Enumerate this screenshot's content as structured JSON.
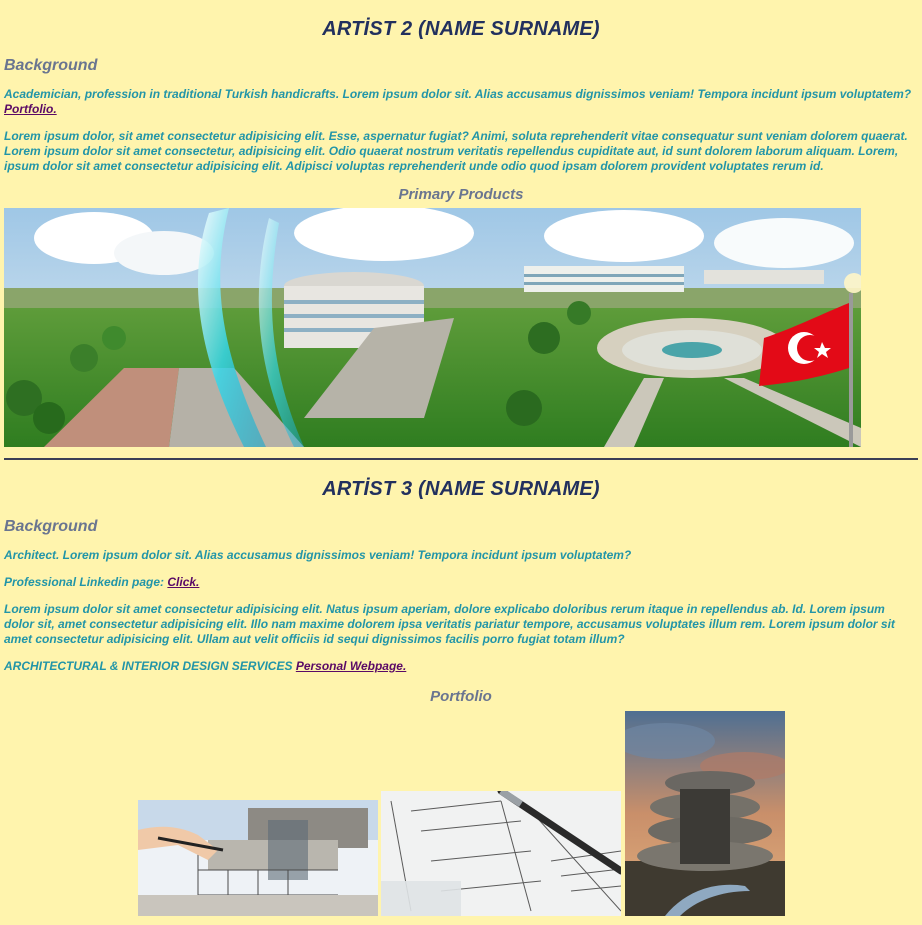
{
  "artist2": {
    "title": "ARTİST 2 (NAME SURNAME)",
    "background_heading": "Background",
    "intro_text": "Academician, profession in traditional Turkish handicrafts. Lorem ipsum dolor sit. Alias accusamus dignissimos veniam! Tempora incidunt ipsum voluptatem? ",
    "portfolio_link": "Portfolio.",
    "body_text": "Lorem ipsum dolor, sit amet consectetur adipisicing elit. Esse, aspernatur fugiat? Animi, soluta reprehenderit vitae consequatur sunt veniam dolorem quaerat. Lorem ipsum dolor sit amet consectetur, adipisicing elit. Odio quaerat nostrum veritatis repellendus cupiditate aut, id sunt dolorem laborum aliquam. Lorem, ipsum dolor sit amet consectetur adipisicing elit. Adipisci voluptas reprehenderit unde odio quod ipsam dolorem provident voluptates rerum id.",
    "products_heading": "Primary Products"
  },
  "artist3": {
    "title": "ARTİST 3 (NAME SURNAME)",
    "background_heading": "Background",
    "intro_text": "Architect. Lorem ipsum dolor sit. Alias accusamus dignissimos veniam! Tempora incidunt ipsum voluptatem?",
    "linkedin_label": "Professional Linkedin page: ",
    "linkedin_link": "Click.",
    "body_text": "Lorem ipsum dolor sit amet consectetur adipisicing elit. Natus ipsum aperiam, dolore explicabo doloribus rerum itaque in repellendus ab. Id. Lorem ipsum dolor sit, amet consectetur adipisicing elit. Illo nam maxime dolorem ipsa veritatis pariatur tempore, accusamus voluptates illum rem. Lorem ipsum dolor sit amet consectetur adipisicing elit. Ullam aut velit officiis id sequi dignissimos facilis porro fugiat totam illum?",
    "services_label": "ARCHITECTURAL & INTERIOR DESIGN SERVICES ",
    "webpage_link": "Personal Webpage.",
    "portfolio_heading": "Portfolio"
  },
  "colors": {
    "background": "#fff4ad",
    "title": "#22305e",
    "heading": "#6a7590",
    "body_text": "#2295a8",
    "link": "#5a0a66"
  }
}
